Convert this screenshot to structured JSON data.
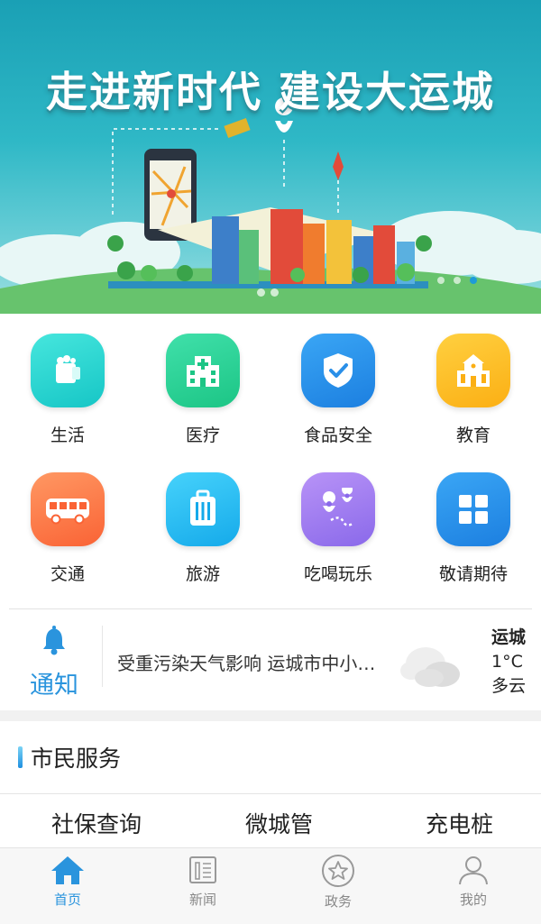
{
  "banner": {
    "title": "走进新时代 建设大运城"
  },
  "grid": [
    {
      "label": "生活",
      "icon": "basket-icon",
      "color": "#25d7d0"
    },
    {
      "label": "医疗",
      "icon": "hospital-icon",
      "color": "#2cd49a"
    },
    {
      "label": "食品安全",
      "icon": "shield-check-icon",
      "color": "#2a8fe8"
    },
    {
      "label": "教育",
      "icon": "school-icon",
      "color": "#ffbf1c"
    },
    {
      "label": "交通",
      "icon": "bus-icon",
      "color": "#ff7a4a"
    },
    {
      "label": "旅游",
      "icon": "luggage-icon",
      "color": "#27bdf0"
    },
    {
      "label": "吃喝玩乐",
      "icon": "map-pins-icon",
      "color": "#9e7cf0"
    },
    {
      "label": "敬请期待",
      "icon": "grid-icon",
      "color": "#2a8fe8"
    }
  ],
  "notice": {
    "label": "通知",
    "text": "受重污染天气影响 运城市中小…",
    "weather": {
      "city": "运城",
      "temp": "1°C",
      "condition": "多云",
      "icon": "cloud-icon"
    }
  },
  "section": {
    "title": "市民服务",
    "items": [
      "社保查询",
      "微城管",
      "充电桩"
    ]
  },
  "tabs": [
    {
      "label": "首页",
      "icon": "home-icon",
      "active": true
    },
    {
      "label": "新闻",
      "icon": "news-icon",
      "active": false
    },
    {
      "label": "政务",
      "icon": "star-circle-icon",
      "active": false
    },
    {
      "label": "我的",
      "icon": "user-icon",
      "active": false
    }
  ],
  "colors": {
    "accent": "#2a94dd",
    "banner": "#1aa0b5"
  }
}
